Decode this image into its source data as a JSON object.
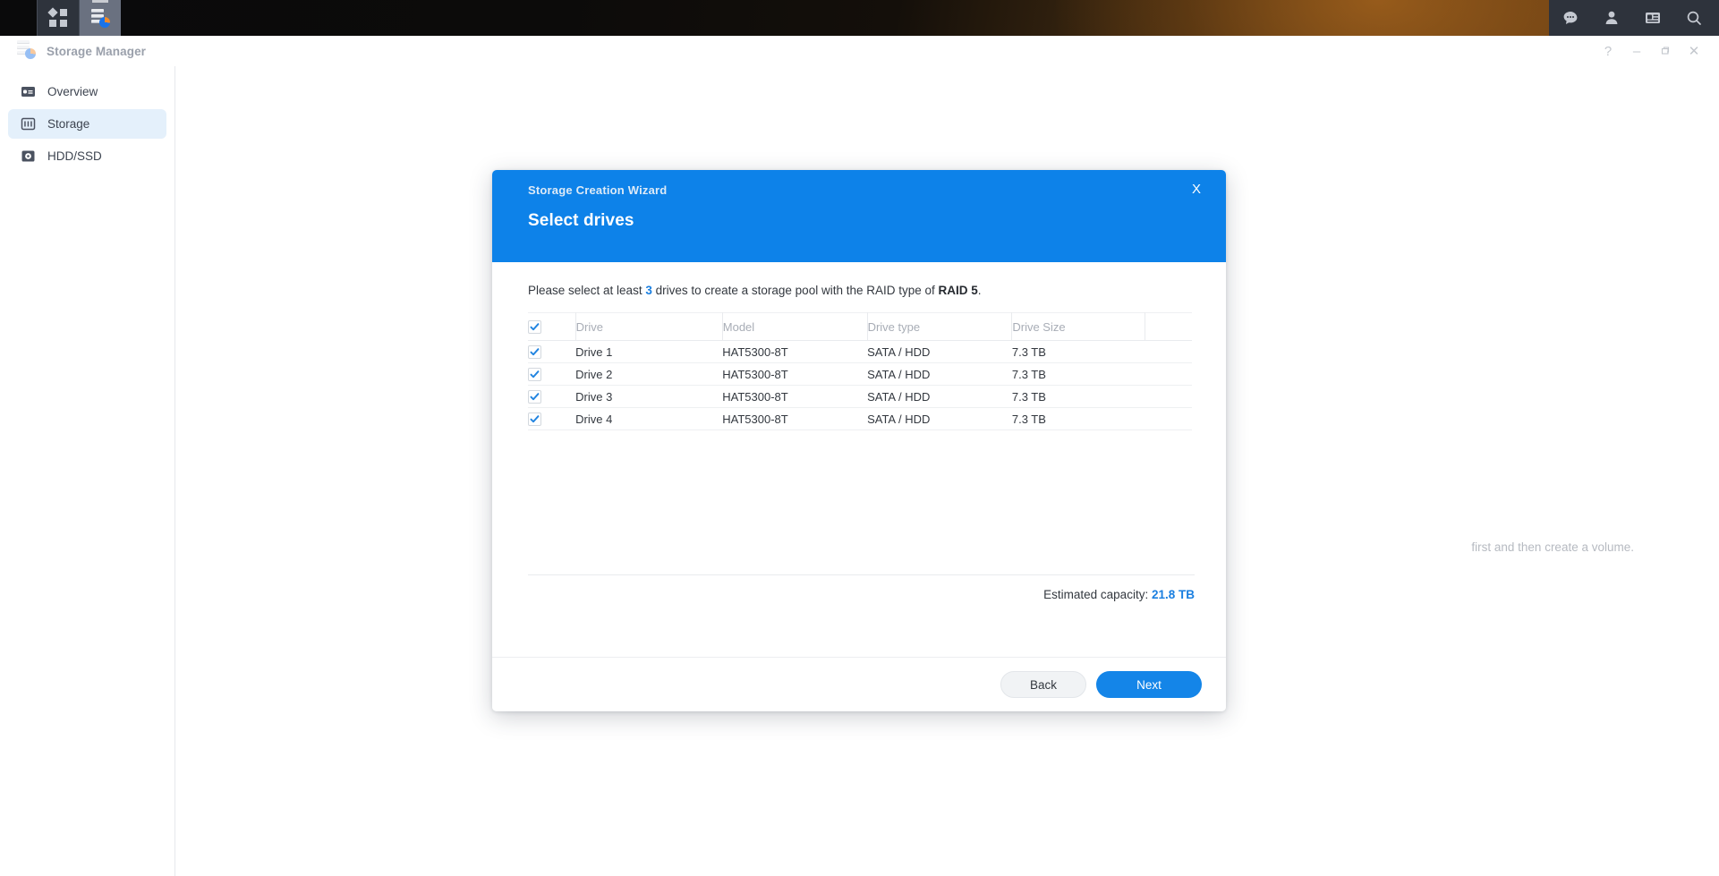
{
  "taskbar": {
    "items": [
      {
        "name": "app-grid",
        "icon": "grid-icon"
      },
      {
        "name": "storage-manager",
        "icon": "storage-manager-icon",
        "active": true
      }
    ],
    "tray": [
      {
        "name": "notifications",
        "icon": "chat-bubble-icon"
      },
      {
        "name": "user-account",
        "icon": "person-icon"
      },
      {
        "name": "widgets",
        "icon": "panel-icon"
      },
      {
        "name": "search",
        "icon": "search-icon"
      }
    ]
  },
  "window": {
    "title": "Storage Manager",
    "controls": {
      "help": "?",
      "minimize": "–",
      "maximize": "❐",
      "close": "✕"
    }
  },
  "sidebar": {
    "items": [
      {
        "label": "Overview",
        "icon": "overview-icon",
        "active": false
      },
      {
        "label": "Storage",
        "icon": "storage-icon",
        "active": true
      },
      {
        "label": "HDD/SSD",
        "icon": "hdd-icon",
        "active": false
      }
    ]
  },
  "main": {
    "background_hint": "first and then create a volume."
  },
  "dialog": {
    "title": "Storage Creation Wizard",
    "subtitle": "Select drives",
    "close_label": "X",
    "instruction": {
      "prefix": "Please select at least ",
      "min_drives": "3",
      "middle": " drives to create a storage pool with the RAID type of ",
      "raid_type": "RAID 5",
      "suffix": "."
    },
    "table": {
      "select_all_checked": true,
      "columns": [
        "Drive",
        "Model",
        "Drive type",
        "Drive Size"
      ],
      "rows": [
        {
          "checked": true,
          "drive": "Drive 1",
          "model": "HAT5300-8T",
          "type": "SATA / HDD",
          "size": "7.3 TB"
        },
        {
          "checked": true,
          "drive": "Drive 2",
          "model": "HAT5300-8T",
          "type": "SATA / HDD",
          "size": "7.3 TB"
        },
        {
          "checked": true,
          "drive": "Drive 3",
          "model": "HAT5300-8T",
          "type": "SATA / HDD",
          "size": "7.3 TB"
        },
        {
          "checked": true,
          "drive": "Drive 4",
          "model": "HAT5300-8T",
          "type": "SATA / HDD",
          "size": "7.3 TB"
        }
      ]
    },
    "capacity_label": "Estimated capacity:",
    "capacity_value": "21.8 TB",
    "buttons": {
      "back": "Back",
      "next": "Next"
    }
  },
  "colors": {
    "accent_blue": "#0d82e9",
    "button_blue": "#1485e8",
    "link_blue": "#1a7fe0",
    "sidebar_active": "#e4f0fb",
    "taskbar": "#2e333c"
  }
}
